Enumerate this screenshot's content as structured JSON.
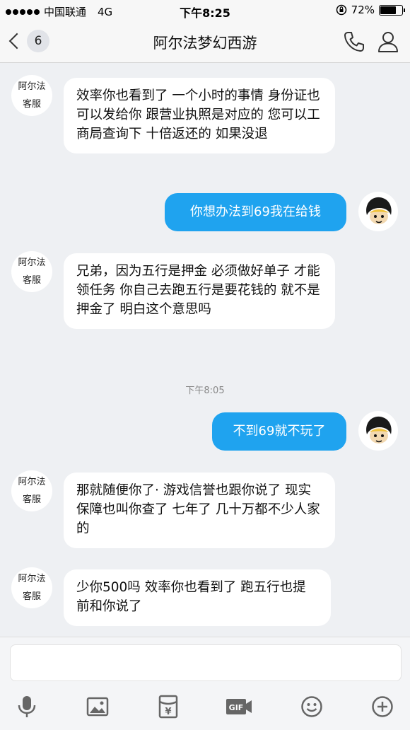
{
  "status_bar": {
    "carrier": "中国联通",
    "network": "4G",
    "time": "下午8:25",
    "battery": "72%"
  },
  "nav": {
    "back_count": "6",
    "title": "阿尔法梦幻西游"
  },
  "contact": {
    "avatar_line1": "阿尔法",
    "avatar_line2": "客服"
  },
  "messages": [
    {
      "side": "left",
      "text": "效率你也看到了 一个小时的事情 身份证也可以发给你 跟营业执照是对应的  您可以工商局查询下 十倍返还的 如果没退"
    },
    {
      "side": "right",
      "text": "你想办法到69我在给钱"
    },
    {
      "side": "left",
      "text": "兄弟，因为五行是押金 必须做好单子 才能领任务 你自己去跑五行是要花钱的 就不是押金了 明白这个意思吗"
    },
    {
      "side": "right",
      "text": "不到69就不玩了"
    },
    {
      "side": "left",
      "text": "那就随便你了· 游戏信誉也跟你说了 现实保障也叫你查了 七年了 几十万都不少人家的"
    },
    {
      "side": "left",
      "text": "少你500吗 效率你也看到了 跑五行也提前和你说了"
    }
  ],
  "timestamp": "下午8:05",
  "toolbar": {
    "items": [
      "mic-icon",
      "image-icon",
      "red-packet-icon",
      "gif-icon",
      "emoji-icon",
      "plus-icon"
    ],
    "gif_label": "GIF",
    "currency_symbol": "¥"
  },
  "colors": {
    "accent": "#1fa3ef",
    "background": "#eef0f3",
    "bubble_left": "#ffffff"
  }
}
